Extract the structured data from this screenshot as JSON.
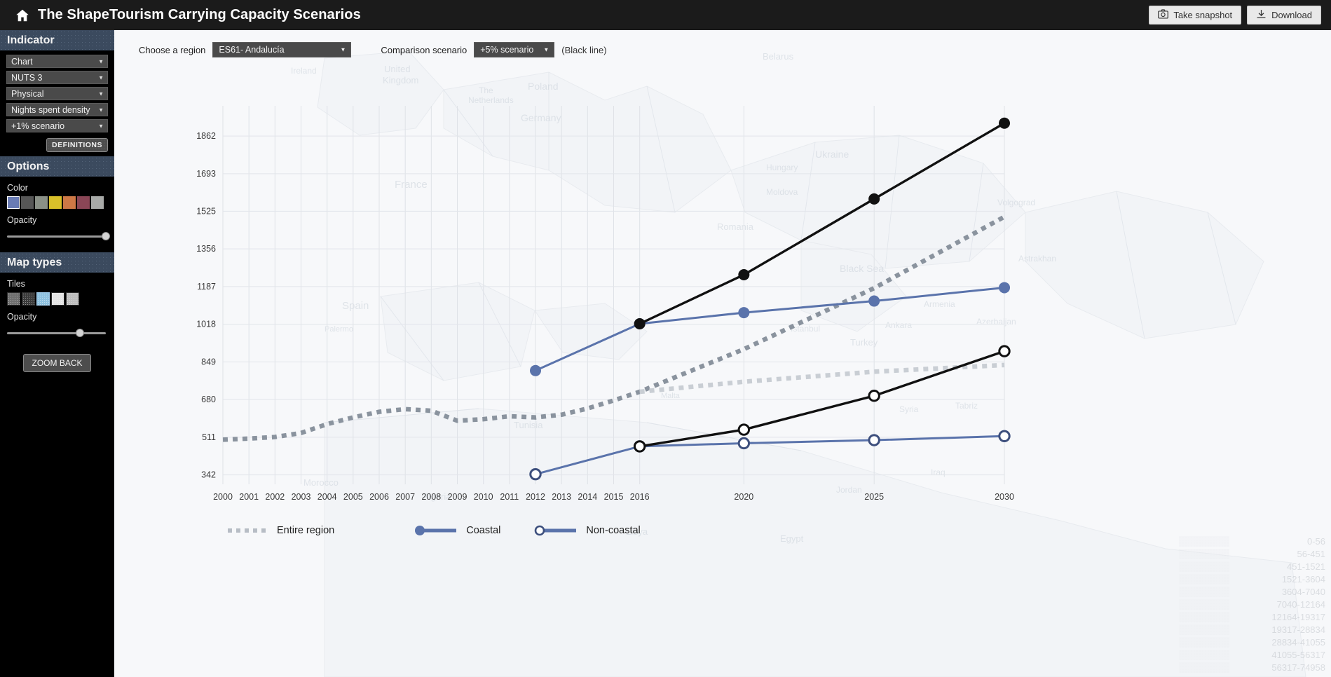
{
  "header": {
    "home_icon": "home-icon",
    "title": "The ShapeTourism Carrying Capacity Scenarios",
    "snapshot_label": "Take snapshot",
    "snapshot_icon": "camera-icon",
    "download_label": "Download",
    "download_icon": "download-icon"
  },
  "sidebar": {
    "indicator_heading": "Indicator",
    "selects": [
      {
        "value": "Chart"
      },
      {
        "value": "NUTS 3"
      },
      {
        "value": "Physical"
      },
      {
        "value": "Nights spent density"
      },
      {
        "value": "+1% scenario"
      }
    ],
    "definitions_label": "DEFINITIONS",
    "options_heading": "Options",
    "color_label": "Color",
    "colors": [
      "#6a7cb4",
      "#575757",
      "#8a9087",
      "#d9c02a",
      "#cd7846",
      "#8a4656",
      "#a8aaa8"
    ],
    "selected_color_index": 0,
    "opacity_label": "Opacity",
    "opacity_value": 100,
    "maptypes_heading": "Map types",
    "tiles_label": "Tiles",
    "tiles": [
      "#6f6f6f",
      "#3b3b3b",
      "#8fc2e0",
      "#e3e3e3",
      "#bdbdbd"
    ],
    "selected_tile_index": 2,
    "tile_opacity_label": "Opacity",
    "tile_opacity_value": 74,
    "zoom_back_label": "ZOOM BACK"
  },
  "controls": {
    "region_label": "Choose a region",
    "region_value": "ES61- Andalucía",
    "scenario_label": "Comparison scenario",
    "scenario_value": "+5% scenario",
    "scenario_note": "(Black line)"
  },
  "map_legend": {
    "ranges": [
      "0-56",
      "56-451",
      "451-1521",
      "1521-3604",
      "3604-7040",
      "7040-12164",
      "12164-19317",
      "19317-28834",
      "28834-41055",
      "41055-56317",
      "56317-74958"
    ]
  },
  "legend": {
    "entire_region": "Entire region",
    "coastal": "Coastal",
    "non_coastal": "Non-coastal"
  },
  "chart_data": {
    "type": "line",
    "title": "",
    "xlabel": "",
    "ylabel": "",
    "grid": true,
    "legend_position": "bottom",
    "x_ticks": [
      "2000",
      "2001",
      "2002",
      "2003",
      "2004",
      "2005",
      "2006",
      "2007",
      "2008",
      "2009",
      "2010",
      "2011",
      "2012",
      "2013",
      "2014",
      "2015",
      "2016",
      "2020",
      "2025",
      "2030"
    ],
    "y_ticks": [
      342,
      511,
      680,
      849,
      1018,
      1187,
      1356,
      1525,
      1693,
      1862
    ],
    "ylim": [
      300,
      1960
    ],
    "colors": {
      "blue": "#5a73ab",
      "black": "#111111",
      "dotted": "#9aa2ab"
    },
    "series": [
      {
        "name": "Entire region",
        "style": "dotted",
        "color": "#8a939e",
        "x": [
          "2000",
          "2001",
          "2002",
          "2003",
          "2004",
          "2005",
          "2006",
          "2007",
          "2008",
          "2009",
          "2010",
          "2011",
          "2012",
          "2013",
          "2014",
          "2015",
          "2016",
          "2020",
          "2025",
          "2030"
        ],
        "values": [
          500,
          505,
          512,
          530,
          570,
          600,
          625,
          637,
          630,
          585,
          592,
          605,
          600,
          612,
          640,
          676,
          715,
          906,
          1180,
          1500
        ]
      },
      {
        "name": "Entire region (light)",
        "style": "dotted-light",
        "color": "#c9ced4",
        "x": [
          "2016",
          "2020",
          "2025",
          "2030"
        ],
        "values": [
          715,
          760,
          805,
          835
        ]
      },
      {
        "name": "Coastal (+1% scenario)",
        "style": "solid-filled",
        "color": "#5a73ab",
        "x": [
          "2012",
          "2016",
          "2020",
          "2025",
          "2030"
        ],
        "values": [
          810,
          1020,
          1070,
          1122,
          1182
        ]
      },
      {
        "name": "Coastal (+5% comparison)",
        "style": "solid-filled",
        "color": "#111111",
        "x": [
          "2016",
          "2020",
          "2025",
          "2030"
        ],
        "values": [
          1020,
          1240,
          1580,
          1920
        ]
      },
      {
        "name": "Non-coastal (+1% scenario)",
        "style": "solid-hollow",
        "color": "#5a73ab",
        "x": [
          "2012",
          "2016",
          "2020",
          "2025",
          "2030"
        ],
        "values": [
          345,
          470,
          484,
          498,
          516
        ]
      },
      {
        "name": "Non-coastal (+5% comparison)",
        "style": "solid-hollow",
        "color": "#111111",
        "x": [
          "2016",
          "2020",
          "2025",
          "2030"
        ],
        "values": [
          470,
          545,
          697,
          897
        ]
      }
    ]
  }
}
